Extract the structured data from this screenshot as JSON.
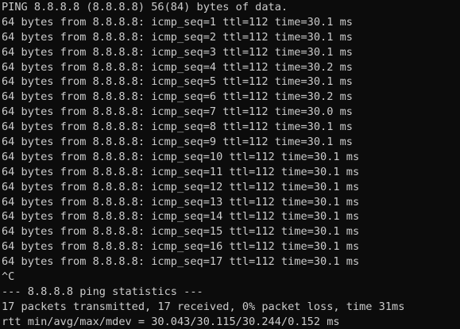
{
  "terminal": {
    "header": "PING 8.8.8.8 (8.8.8.8) 56(84) bytes of data.",
    "replies": [
      "64 bytes from 8.8.8.8: icmp_seq=1 ttl=112 time=30.1 ms",
      "64 bytes from 8.8.8.8: icmp_seq=2 ttl=112 time=30.1 ms",
      "64 bytes from 8.8.8.8: icmp_seq=3 ttl=112 time=30.1 ms",
      "64 bytes from 8.8.8.8: icmp_seq=4 ttl=112 time=30.2 ms",
      "64 bytes from 8.8.8.8: icmp_seq=5 ttl=112 time=30.1 ms",
      "64 bytes from 8.8.8.8: icmp_seq=6 ttl=112 time=30.2 ms",
      "64 bytes from 8.8.8.8: icmp_seq=7 ttl=112 time=30.0 ms",
      "64 bytes from 8.8.8.8: icmp_seq=8 ttl=112 time=30.1 ms",
      "64 bytes from 8.8.8.8: icmp_seq=9 ttl=112 time=30.1 ms",
      "64 bytes from 8.8.8.8: icmp_seq=10 ttl=112 time=30.1 ms",
      "64 bytes from 8.8.8.8: icmp_seq=11 ttl=112 time=30.1 ms",
      "64 bytes from 8.8.8.8: icmp_seq=12 ttl=112 time=30.1 ms",
      "64 bytes from 8.8.8.8: icmp_seq=13 ttl=112 time=30.1 ms",
      "64 bytes from 8.8.8.8: icmp_seq=14 ttl=112 time=30.1 ms",
      "64 bytes from 8.8.8.8: icmp_seq=15 ttl=112 time=30.1 ms",
      "64 bytes from 8.8.8.8: icmp_seq=16 ttl=112 time=30.1 ms",
      "64 bytes from 8.8.8.8: icmp_seq=17 ttl=112 time=30.1 ms"
    ],
    "interrupt": "^C",
    "stats_header": "--- 8.8.8.8 ping statistics ---",
    "stats_summary": "17 packets transmitted, 17 received, 0% packet loss, time 31ms",
    "rtt_summary": "rtt min/avg/max/mdev = 30.043/30.115/30.244/0.152 ms"
  },
  "colors": {
    "background": "#0c0c0c",
    "text": "#cccccc"
  }
}
